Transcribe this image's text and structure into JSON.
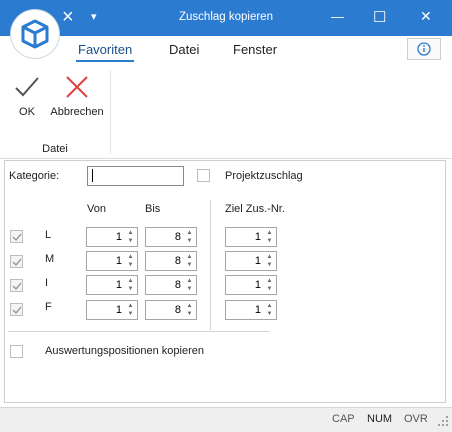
{
  "window": {
    "title": "Zuschlag kopieren",
    "accent": "#2b7bd1"
  },
  "titlebar_icons": {
    "close_small": "×",
    "dropdown": "▾",
    "minimize": "—",
    "maximize": "☐",
    "close": "✕"
  },
  "tabs": [
    {
      "label": "Favoriten",
      "active": true
    },
    {
      "label": "Datei",
      "active": false
    },
    {
      "label": "Fenster",
      "active": false
    }
  ],
  "ribbon": {
    "ok_label": "OK",
    "cancel_label": "Abbrechen",
    "group_label": "Datei",
    "info_icon": "i"
  },
  "form": {
    "kategorie_label": "Kategorie:",
    "kategorie_value": "",
    "projektzuschlag_label": "Projektzuschlag",
    "projektzuschlag_checked": false,
    "col_von": "Von",
    "col_bis": "Bis",
    "col_ziel": "Ziel Zus.-Nr.",
    "rows": [
      {
        "checked": true,
        "label": "L",
        "von": "1",
        "bis": "8",
        "ziel": "1"
      },
      {
        "checked": true,
        "label": "M",
        "von": "1",
        "bis": "8",
        "ziel": "1"
      },
      {
        "checked": true,
        "label": "I",
        "von": "1",
        "bis": "8",
        "ziel": "1"
      },
      {
        "checked": true,
        "label": "F",
        "von": "1",
        "bis": "8",
        "ziel": "1"
      }
    ],
    "auswertung_label": "Auswertungspositionen kopieren",
    "auswertung_checked": false
  },
  "statusbar": {
    "cap": "CAP",
    "num": "NUM",
    "ovr": "OVR"
  }
}
